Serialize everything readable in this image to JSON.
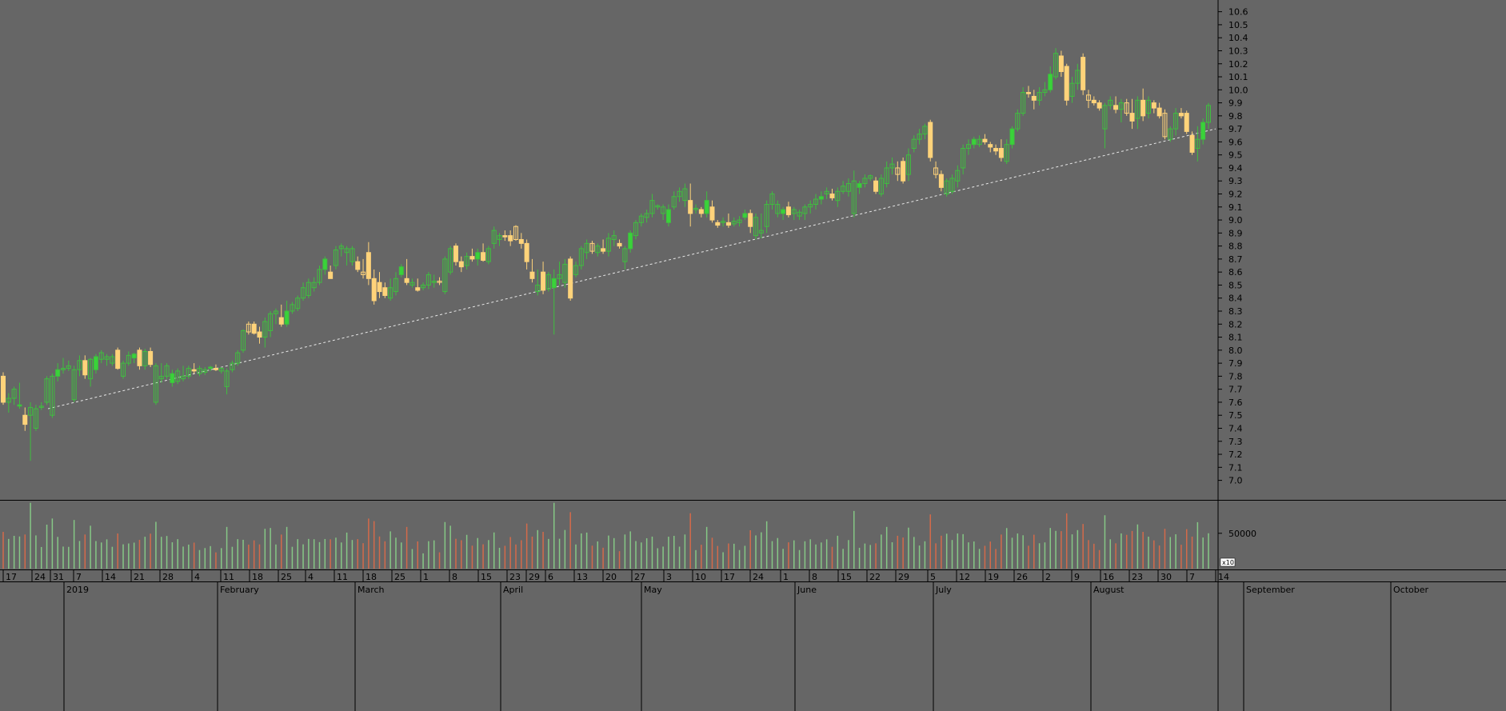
{
  "colors": {
    "background": "#666666",
    "up_outline": "#3fbf3f",
    "up_fill": "#39d339",
    "down_fill": "#ffd37a",
    "down_outline": "#ffd37a",
    "vol_up": "#86c886",
    "vol_down": "#d46a4a",
    "axis_line": "#000000",
    "trendline": "#ffffff"
  },
  "chart_data": {
    "type": "candlestick",
    "title": "",
    "price_axis": {
      "ylim": [
        6.85,
        10.69
      ],
      "ticks": [
        "7.0",
        "7.1",
        "7.2",
        "7.3",
        "7.4",
        "7.5",
        "7.6",
        "7.7",
        "7.8",
        "7.9",
        "8.0",
        "8.1",
        "8.2",
        "8.3",
        "8.4",
        "8.5",
        "8.6",
        "8.7",
        "8.8",
        "8.9",
        "9.0",
        "9.1",
        "9.2",
        "9.3",
        "9.4",
        "9.5",
        "9.6",
        "9.7",
        "9.8",
        "9.9",
        "10.0",
        "10.1",
        "10.2",
        "10.3",
        "10.4",
        "10.5",
        "10.6"
      ]
    },
    "volume_axis": {
      "tick": "50000",
      "multiplier": "x10",
      "max": 95000
    },
    "x_axis": {
      "days": [
        "17",
        "24",
        "31",
        "7",
        "14",
        "21",
        "28",
        "4",
        "11",
        "18",
        "25",
        "4",
        "11",
        "18",
        "25",
        "1",
        "8",
        "15",
        "23",
        "29",
        "6",
        "13",
        "20",
        "27",
        "3",
        "10",
        "17",
        "24",
        "1",
        "8",
        "15",
        "22",
        "29",
        "5",
        "12",
        "19",
        "26",
        "2",
        "9",
        "16",
        "23",
        "30",
        "7",
        "14"
      ],
      "months": [
        "2019",
        "February",
        "March",
        "April",
        "May",
        "June",
        "July",
        "August",
        "September",
        "October"
      ]
    },
    "trendline": {
      "x": [
        "2019-01-30",
        "2019-10-15"
      ],
      "y": [
        7.55,
        9.7
      ]
    },
    "candles": [
      [
        7.8,
        7.83,
        7.58,
        7.6
      ],
      [
        7.6,
        7.67,
        7.52,
        7.63
      ],
      [
        7.63,
        7.72,
        7.58,
        7.7
      ],
      [
        7.57,
        7.75,
        7.55,
        7.58
      ],
      [
        7.5,
        7.56,
        7.38,
        7.43
      ],
      [
        7.5,
        7.6,
        7.15,
        7.56
      ],
      [
        7.4,
        7.58,
        7.38,
        7.55
      ],
      [
        7.56,
        7.6,
        7.54,
        7.57
      ],
      [
        7.6,
        7.8,
        7.58,
        7.78
      ],
      [
        7.5,
        7.82,
        7.48,
        7.8
      ],
      [
        7.8,
        7.9,
        7.76,
        7.85
      ],
      [
        7.85,
        7.94,
        7.82,
        7.86
      ],
      [
        7.86,
        7.92,
        7.84,
        7.88
      ],
      [
        7.62,
        7.88,
        7.6,
        7.85
      ],
      [
        7.85,
        7.96,
        7.8,
        7.92
      ],
      [
        7.92,
        7.96,
        7.78,
        7.81
      ],
      [
        7.78,
        7.94,
        7.72,
        7.93
      ],
      [
        7.85,
        7.97,
        7.82,
        7.95
      ],
      [
        7.93,
        8.0,
        7.9,
        7.98
      ],
      [
        7.93,
        7.97,
        7.88,
        7.95
      ],
      [
        7.9,
        7.97,
        7.88,
        7.95
      ],
      [
        8.0,
        8.02,
        7.85,
        7.86
      ],
      [
        7.8,
        7.92,
        7.78,
        7.9
      ],
      [
        7.9,
        7.99,
        7.88,
        7.96
      ],
      [
        7.94,
        7.98,
        7.9,
        7.97
      ],
      [
        8.0,
        8.02,
        7.85,
        7.88
      ],
      [
        7.88,
        8.01,
        7.85,
        7.99
      ],
      [
        7.99,
        8.02,
        7.87,
        7.89
      ],
      [
        7.6,
        7.9,
        7.58,
        7.88
      ],
      [
        7.78,
        7.9,
        7.75,
        7.8
      ],
      [
        7.8,
        7.9,
        7.78,
        7.88
      ],
      [
        7.75,
        7.85,
        7.72,
        7.82
      ],
      [
        7.76,
        7.86,
        7.74,
        7.84
      ],
      [
        7.78,
        7.88,
        7.76,
        7.8
      ],
      [
        7.8,
        7.88,
        7.78,
        7.86
      ],
      [
        7.85,
        7.9,
        7.82,
        7.84
      ],
      [
        7.82,
        7.88,
        7.8,
        7.86
      ],
      [
        7.83,
        7.87,
        7.81,
        7.85
      ],
      [
        7.86,
        7.88,
        7.84,
        7.87
      ],
      [
        7.86,
        7.89,
        7.84,
        7.85
      ],
      [
        7.84,
        7.87,
        7.82,
        7.86
      ],
      [
        7.72,
        7.86,
        7.66,
        7.84
      ],
      [
        7.85,
        7.92,
        7.83,
        7.9
      ],
      [
        7.9,
        8.0,
        7.88,
        7.98
      ],
      [
        8.0,
        8.16,
        7.98,
        8.15
      ],
      [
        8.2,
        8.22,
        8.12,
        8.14
      ],
      [
        8.2,
        8.22,
        8.12,
        8.13
      ],
      [
        8.14,
        8.18,
        8.05,
        8.1
      ],
      [
        8.1,
        8.25,
        8.02,
        8.22
      ],
      [
        8.15,
        8.3,
        8.1,
        8.28
      ],
      [
        8.28,
        8.32,
        8.2,
        8.3
      ],
      [
        8.25,
        8.35,
        8.18,
        8.2
      ],
      [
        8.2,
        8.38,
        8.18,
        8.3
      ],
      [
        8.3,
        8.37,
        8.28,
        8.35
      ],
      [
        8.32,
        8.42,
        8.3,
        8.4
      ],
      [
        8.4,
        8.52,
        8.38,
        8.48
      ],
      [
        8.42,
        8.55,
        8.4,
        8.52
      ],
      [
        8.48,
        8.56,
        8.45,
        8.52
      ],
      [
        8.52,
        8.65,
        8.5,
        8.62
      ],
      [
        8.62,
        8.72,
        8.58,
        8.7
      ],
      [
        8.6,
        8.65,
        8.55,
        8.55
      ],
      [
        8.65,
        8.8,
        8.62,
        8.77
      ],
      [
        8.78,
        8.82,
        8.72,
        8.8
      ],
      [
        8.75,
        8.8,
        8.65,
        8.78
      ],
      [
        8.68,
        8.8,
        8.65,
        8.78
      ],
      [
        8.68,
        8.72,
        8.6,
        8.62
      ],
      [
        8.6,
        8.7,
        8.55,
        8.58
      ],
      [
        8.75,
        8.83,
        8.5,
        8.55
      ],
      [
        8.55,
        8.62,
        8.35,
        8.38
      ],
      [
        8.52,
        8.6,
        8.4,
        8.45
      ],
      [
        8.48,
        8.52,
        8.4,
        8.42
      ],
      [
        8.4,
        8.55,
        8.38,
        8.48
      ],
      [
        8.45,
        8.6,
        8.42,
        8.55
      ],
      [
        8.58,
        8.66,
        8.56,
        8.64
      ],
      [
        8.55,
        8.7,
        8.5,
        8.52
      ],
      [
        8.5,
        8.55,
        8.48,
        8.52
      ],
      [
        8.48,
        8.55,
        8.45,
        8.46
      ],
      [
        8.48,
        8.52,
        8.46,
        8.5
      ],
      [
        8.5,
        8.6,
        8.47,
        8.58
      ],
      [
        8.52,
        8.58,
        8.48,
        8.53
      ],
      [
        8.53,
        8.56,
        8.5,
        8.52
      ],
      [
        8.45,
        8.72,
        8.43,
        8.7
      ],
      [
        8.6,
        8.8,
        8.58,
        8.78
      ],
      [
        8.8,
        8.82,
        8.65,
        8.68
      ],
      [
        8.68,
        8.72,
        8.6,
        8.64
      ],
      [
        8.65,
        8.75,
        8.62,
        8.72
      ],
      [
        8.72,
        8.78,
        8.68,
        8.7
      ],
      [
        8.7,
        8.78,
        8.65,
        8.75
      ],
      [
        8.75,
        8.82,
        8.68,
        8.69
      ],
      [
        8.68,
        8.8,
        8.66,
        8.78
      ],
      [
        8.82,
        8.95,
        8.78,
        8.92
      ],
      [
        8.85,
        8.9,
        8.8,
        8.88
      ],
      [
        8.88,
        8.92,
        8.84,
        8.87
      ],
      [
        8.88,
        8.92,
        8.8,
        8.84
      ],
      [
        8.95,
        8.96,
        8.84,
        8.85
      ],
      [
        8.85,
        8.9,
        8.78,
        8.82
      ],
      [
        8.82,
        8.85,
        8.62,
        8.68
      ],
      [
        8.6,
        8.7,
        8.52,
        8.55
      ],
      [
        8.45,
        8.62,
        8.42,
        8.5
      ],
      [
        8.6,
        8.68,
        8.43,
        8.46
      ],
      [
        8.47,
        8.6,
        8.45,
        8.58
      ],
      [
        8.48,
        8.62,
        8.12,
        8.55
      ],
      [
        8.55,
        8.68,
        8.5,
        8.58
      ],
      [
        8.52,
        8.7,
        8.48,
        8.66
      ],
      [
        8.7,
        8.72,
        8.38,
        8.4
      ],
      [
        8.58,
        8.68,
        8.56,
        8.65
      ],
      [
        8.65,
        8.8,
        8.62,
        8.78
      ],
      [
        8.75,
        8.85,
        8.7,
        8.82
      ],
      [
        8.82,
        8.84,
        8.74,
        8.76
      ],
      [
        8.75,
        8.82,
        8.72,
        8.8
      ],
      [
        8.78,
        8.85,
        8.74,
        8.76
      ],
      [
        8.76,
        8.9,
        8.72,
        8.86
      ],
      [
        8.85,
        8.92,
        8.8,
        8.88
      ],
      [
        8.82,
        8.85,
        8.78,
        8.8
      ],
      [
        8.68,
        8.8,
        8.62,
        8.78
      ],
      [
        8.78,
        8.92,
        8.75,
        8.9
      ],
      [
        8.88,
        9.0,
        8.85,
        8.98
      ],
      [
        8.98,
        9.05,
        8.95,
        9.03
      ],
      [
        9.02,
        9.08,
        8.98,
        9.05
      ],
      [
        9.05,
        9.2,
        9.02,
        9.15
      ],
      [
        9.1,
        9.12,
        9.08,
        9.11
      ],
      [
        9.05,
        9.12,
        9.0,
        9.1
      ],
      [
        8.98,
        9.12,
        8.95,
        9.08
      ],
      [
        9.1,
        9.22,
        9.08,
        9.18
      ],
      [
        9.18,
        9.25,
        9.14,
        9.22
      ],
      [
        9.15,
        9.28,
        9.1,
        9.24
      ],
      [
        9.15,
        9.28,
        8.95,
        9.05
      ],
      [
        9.08,
        9.12,
        9.05,
        9.09
      ],
      [
        9.08,
        9.1,
        9.02,
        9.05
      ],
      [
        9.05,
        9.22,
        9.02,
        9.15
      ],
      [
        9.1,
        9.15,
        8.98,
        9.0
      ],
      [
        8.98,
        9.0,
        8.94,
        8.96
      ],
      [
        8.98,
        9.02,
        8.95,
        8.99
      ],
      [
        8.98,
        9.05,
        8.94,
        8.96
      ],
      [
        8.97,
        9.02,
        8.95,
        8.99
      ],
      [
        8.98,
        9.03,
        8.95,
        9.0
      ],
      [
        9.02,
        9.08,
        9.0,
        9.05
      ],
      [
        9.05,
        9.08,
        8.9,
        8.95
      ],
      [
        8.88,
        9.05,
        8.85,
        9.02
      ],
      [
        8.9,
        9.05,
        8.86,
        8.92
      ],
      [
        8.95,
        9.15,
        8.9,
        9.12
      ],
      [
        9.12,
        9.22,
        9.08,
        9.2
      ],
      [
        9.05,
        9.15,
        9.02,
        9.12
      ],
      [
        9.05,
        9.1,
        9.0,
        9.08
      ],
      [
        9.1,
        9.14,
        9.02,
        9.04
      ],
      [
        9.05,
        9.1,
        9.0,
        9.08
      ],
      [
        9.03,
        9.08,
        9.0,
        9.06
      ],
      [
        9.05,
        9.12,
        9.0,
        9.1
      ],
      [
        9.1,
        9.15,
        9.05,
        9.12
      ],
      [
        9.12,
        9.2,
        9.08,
        9.16
      ],
      [
        9.16,
        9.22,
        9.12,
        9.18
      ],
      [
        9.2,
        9.25,
        9.16,
        9.22
      ],
      [
        9.2,
        9.24,
        9.15,
        9.17
      ],
      [
        9.15,
        9.25,
        9.1,
        9.22
      ],
      [
        9.22,
        9.3,
        9.2,
        9.26
      ],
      [
        9.22,
        9.32,
        9.18,
        9.28
      ],
      [
        9.05,
        9.38,
        9.02,
        9.3
      ],
      [
        9.25,
        9.3,
        9.2,
        9.28
      ],
      [
        9.28,
        9.35,
        9.25,
        9.32
      ],
      [
        9.32,
        9.35,
        9.3,
        9.34
      ],
      [
        9.3,
        9.33,
        9.2,
        9.22
      ],
      [
        9.2,
        9.35,
        9.18,
        9.32
      ],
      [
        9.28,
        9.45,
        9.25,
        9.4
      ],
      [
        9.4,
        9.48,
        9.35,
        9.43
      ],
      [
        9.4,
        9.45,
        9.3,
        9.35
      ],
      [
        9.45,
        9.48,
        9.28,
        9.3
      ],
      [
        9.35,
        9.55,
        9.3,
        9.5
      ],
      [
        9.55,
        9.65,
        9.52,
        9.62
      ],
      [
        9.62,
        9.7,
        9.58,
        9.66
      ],
      [
        9.66,
        9.74,
        9.62,
        9.72
      ],
      [
        9.75,
        9.77,
        9.45,
        9.48
      ],
      [
        9.4,
        9.45,
        9.32,
        9.35
      ],
      [
        9.35,
        9.38,
        9.22,
        9.25
      ],
      [
        9.2,
        9.32,
        9.18,
        9.3
      ],
      [
        9.22,
        9.35,
        9.2,
        9.32
      ],
      [
        9.3,
        9.42,
        9.25,
        9.38
      ],
      [
        9.4,
        9.58,
        9.35,
        9.55
      ],
      [
        9.55,
        9.62,
        9.5,
        9.58
      ],
      [
        9.58,
        9.64,
        9.55,
        9.62
      ],
      [
        9.58,
        9.65,
        9.56,
        9.62
      ],
      [
        9.62,
        9.66,
        9.58,
        9.6
      ],
      [
        9.58,
        9.6,
        9.52,
        9.56
      ],
      [
        9.55,
        9.58,
        9.5,
        9.53
      ],
      [
        9.55,
        9.62,
        9.45,
        9.48
      ],
      [
        9.45,
        9.62,
        9.43,
        9.58
      ],
      [
        9.58,
        9.72,
        9.55,
        9.7
      ],
      [
        9.7,
        9.85,
        9.68,
        9.82
      ],
      [
        9.82,
        10.02,
        9.8,
        9.98
      ],
      [
        9.98,
        10.03,
        9.94,
        9.97
      ],
      [
        9.95,
        10.0,
        9.85,
        9.92
      ],
      [
        9.92,
        10.02,
        9.88,
        9.98
      ],
      [
        9.98,
        10.06,
        9.95,
        10.0
      ],
      [
        10.0,
        10.18,
        9.98,
        10.12
      ],
      [
        10.1,
        10.32,
        10.08,
        10.28
      ],
      [
        10.26,
        10.3,
        10.1,
        10.14
      ],
      [
        10.18,
        10.2,
        9.88,
        9.92
      ],
      [
        9.95,
        10.1,
        9.9,
        10.05
      ],
      [
        10.05,
        10.2,
        10.0,
        10.15
      ],
      [
        10.25,
        10.28,
        9.96,
        10.0
      ],
      [
        9.96,
        10.0,
        9.86,
        9.92
      ],
      [
        9.92,
        9.95,
        9.88,
        9.9
      ],
      [
        9.9,
        9.92,
        9.84,
        9.86
      ],
      [
        9.7,
        9.9,
        9.55,
        9.88
      ],
      [
        9.88,
        9.95,
        9.85,
        9.92
      ],
      [
        9.88,
        9.95,
        9.82,
        9.85
      ],
      [
        9.85,
        9.93,
        9.75,
        9.9
      ],
      [
        9.9,
        9.93,
        9.8,
        9.82
      ],
      [
        9.82,
        9.93,
        9.7,
        9.76
      ],
      [
        9.78,
        9.95,
        9.7,
        9.92
      ],
      [
        9.92,
        10.01,
        9.76,
        9.8
      ],
      [
        9.82,
        9.95,
        9.78,
        9.92
      ],
      [
        9.9,
        9.92,
        9.82,
        9.86
      ],
      [
        9.86,
        9.9,
        9.78,
        9.8
      ],
      [
        9.82,
        9.85,
        9.62,
        9.64
      ],
      [
        9.62,
        9.72,
        9.6,
        9.7
      ],
      [
        9.7,
        9.86,
        9.65,
        9.82
      ],
      [
        9.82,
        9.86,
        9.78,
        9.8
      ],
      [
        9.82,
        9.84,
        9.66,
        9.68
      ],
      [
        9.65,
        9.68,
        9.5,
        9.52
      ],
      [
        9.55,
        9.72,
        9.45,
        9.62
      ],
      [
        9.62,
        9.78,
        9.58,
        9.75
      ],
      [
        9.75,
        9.9,
        9.7,
        9.88
      ]
    ]
  }
}
